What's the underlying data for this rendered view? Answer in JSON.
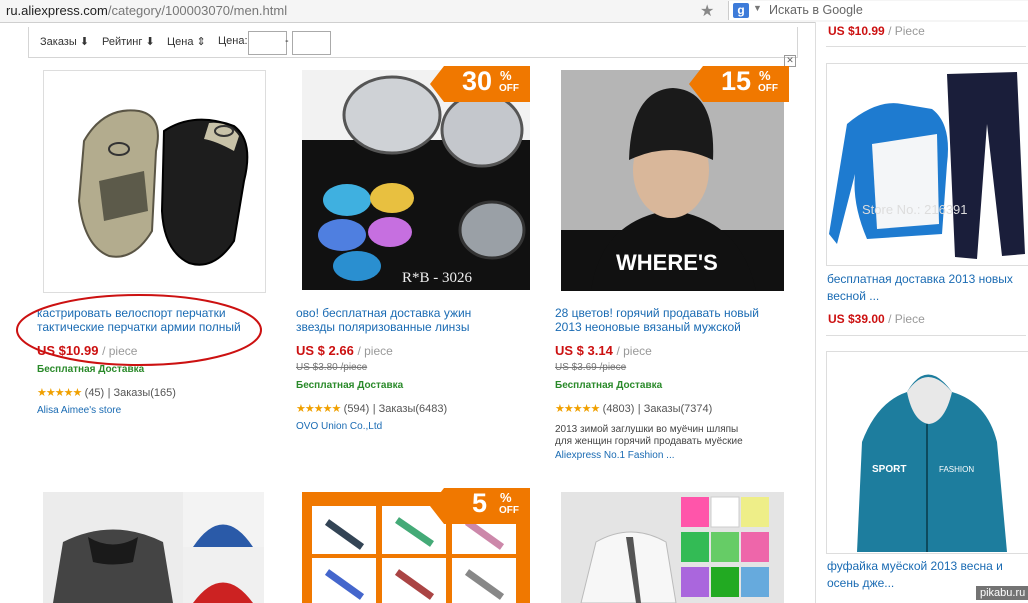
{
  "browser": {
    "url_domain": "ru.aliexpress.com",
    "url_path": "/category/100003070/men.html",
    "search_engine": "g",
    "search_placeholder": "Искать в Google"
  },
  "filters": {
    "orders_label": "Заказы",
    "rating_label": "Рейтинг",
    "price_label": "Цена",
    "price_range_label": "Цена:",
    "range_sep": "-",
    "min_value": "",
    "max_value": ""
  },
  "products": [
    {
      "title_line1": "кастрировать велоспорт перчатки",
      "title_line2": "тактические перчатки армии полный",
      "price": "US $10.99",
      "unit": "/ piece",
      "shipping": "Бесплатная Доставка",
      "stars": "★★★★★",
      "reviews": "(45)",
      "orders": "Заказы(165)",
      "store": "Alisa Aimee's store"
    },
    {
      "title_line1": "ово! бесплатная доставка ужин",
      "title_line2": "звезды поляризованные линзы",
      "price": "US $ 2.66",
      "unit": "/ piece",
      "old_price": "US $3.80 /piece",
      "shipping": "Бесплатная Доставка",
      "stars": "★★★★★",
      "reviews": "(594)",
      "orders": "Заказы(6483)",
      "store": "OVO Union Co.,Ltd",
      "badge": {
        "value": "30",
        "sign": "%",
        "text": "OFF"
      },
      "image_text": "R*B - 3026"
    },
    {
      "title_line1": "28 цветов! горячий продавать новый",
      "title_line2": "2013 неоновые вязаный мужской",
      "price": "US $ 3.14",
      "unit": "/ piece",
      "old_price": "US $3.69 /piece",
      "shipping": "Бесплатная Доставка",
      "stars": "★★★★★",
      "reviews": "(4803)",
      "orders": "Заказы(7374)",
      "desc_line1": "2013 зимой заглушки во муёчин шляпы",
      "desc_line2": "для женщин горячий продавать муёские",
      "store": "Aliexpress No.1 Fashion ...",
      "badge": {
        "value": "15",
        "sign": "%",
        "text": "OFF"
      },
      "image_text": "WHERE'S"
    }
  ],
  "bottom_badge": {
    "value": "5",
    "sign": "%",
    "text": "OFF"
  },
  "sidebar": {
    "top_price": "US $10.99",
    "top_unit": "/ Piece",
    "items": [
      {
        "title_line1": "бесплатная доставка 2013 новых",
        "title_line2": "весной ...",
        "price": "US $39.00",
        "unit": "/ Piece",
        "image_text": "Store No.: 216391"
      },
      {
        "title_line1": "фуфайка муёской 2013 весна и",
        "title_line2": "осень дже...",
        "image_text_1": "SPORT",
        "image_text_2": "FASHION"
      }
    ]
  },
  "watermark": "pikabu.ru",
  "colors": {
    "accent_blue": "#1a6bb3",
    "price_red": "#cc1111",
    "discount_orange": "#f07800",
    "ship_green": "#2a8a2a",
    "annotation_red": "#cc1111"
  }
}
